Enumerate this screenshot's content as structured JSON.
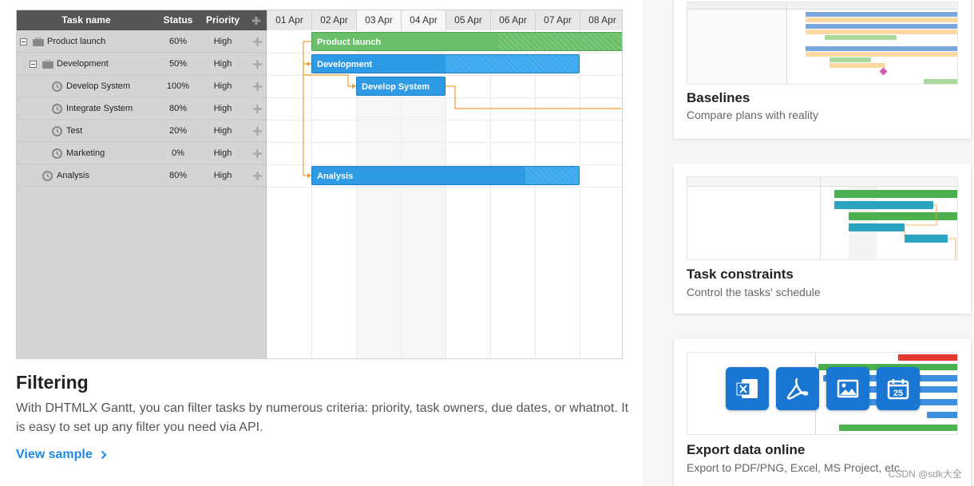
{
  "gantt": {
    "columns": {
      "task": "Task name",
      "status": "Status",
      "priority": "Priority"
    },
    "scale": [
      "01 Apr",
      "02 Apr",
      "03 Apr",
      "04 Apr",
      "05 Apr",
      "06 Apr",
      "07 Apr",
      "08 Apr"
    ],
    "rows": [
      {
        "name": "Product launch",
        "status": "60%",
        "priority": "High"
      },
      {
        "name": "Development",
        "status": "50%",
        "priority": "High"
      },
      {
        "name": "Develop System",
        "status": "100%",
        "priority": "High"
      },
      {
        "name": "Integrate System",
        "status": "80%",
        "priority": "High"
      },
      {
        "name": "Test",
        "status": "20%",
        "priority": "High"
      },
      {
        "name": "Marketing",
        "status": "0%",
        "priority": "High"
      },
      {
        "name": "Analysis",
        "status": "80%",
        "priority": "High"
      }
    ],
    "bars": [
      {
        "label": "Product launch",
        "progress": 0.6,
        "color": "#6abf69"
      },
      {
        "label": "Development",
        "progress": 0.5,
        "color": "#2d9ae5"
      },
      {
        "label": "Develop System",
        "progress": 1.0,
        "color": "#2d9ae5"
      },
      {
        "label": "Analysis",
        "progress": 0.8,
        "color": "#2d9ae5"
      }
    ]
  },
  "filtering": {
    "title": "Filtering",
    "description": "With DHTMLX Gantt, you can filter tasks by numerous criteria: priority, task owners, due dates, or whatnot. It is easy to set up any filter you need via API.",
    "link": "View sample"
  },
  "cards": [
    {
      "title": "Baselines",
      "subtitle": "Compare plans with reality"
    },
    {
      "title": "Task constraints",
      "subtitle": "Control the tasks' schedule"
    },
    {
      "title": "Export data online",
      "subtitle": "Export to PDF/PNG, Excel, MS Project, etc."
    }
  ],
  "watermark": "CSDN @sdk大全",
  "colors": {
    "accent": "#1e88e5",
    "bar_blue": "#2d9ae5",
    "bar_green": "#6abf69",
    "header": "#555555",
    "link_arrow": "#f0a030"
  }
}
